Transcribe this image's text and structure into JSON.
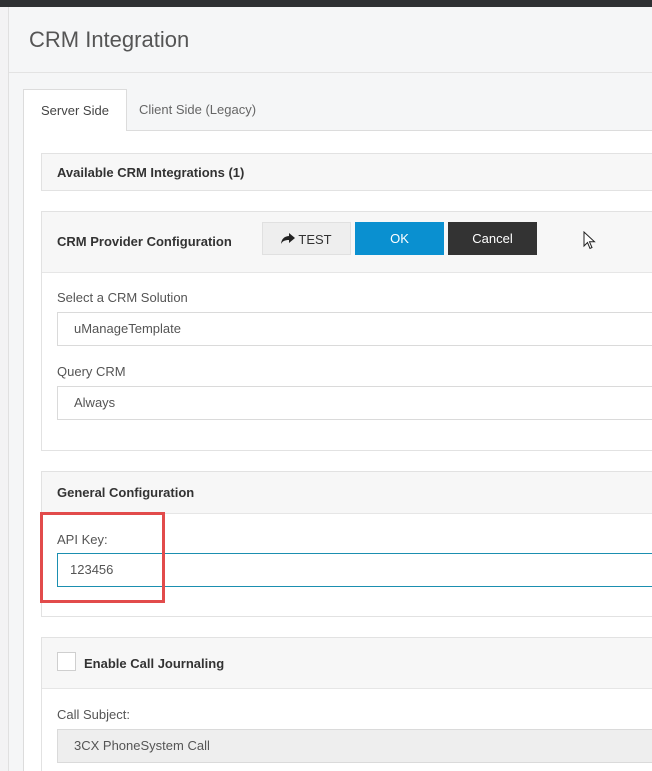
{
  "page": {
    "title": "CRM Integration"
  },
  "tabs": [
    {
      "label": "Server Side",
      "active": true
    },
    {
      "label": "Client Side (Legacy)",
      "active": false
    }
  ],
  "available": {
    "title": "Available CRM Integrations (1)"
  },
  "provider": {
    "title": "CRM Provider Configuration",
    "test_label": "TEST",
    "ok_label": "OK",
    "cancel_label": "Cancel",
    "solution_label": "Select a CRM Solution",
    "solution_value": "uManageTemplate",
    "query_label": "Query CRM",
    "query_value": "Always"
  },
  "general": {
    "title": "General Configuration",
    "api_key_label": "API Key:",
    "api_key_value": "123456"
  },
  "journaling": {
    "checkbox_label": "Enable Call Journaling",
    "checked": false,
    "subject_label": "Call Subject:",
    "subject_value": "3CX PhoneSystem Call"
  },
  "colors": {
    "accent": "#0a90d0",
    "cancel": "#333333",
    "highlight": "#e24b4b"
  },
  "icons": {
    "test": "share-arrow-icon",
    "cursor": "mouse-pointer-icon"
  }
}
